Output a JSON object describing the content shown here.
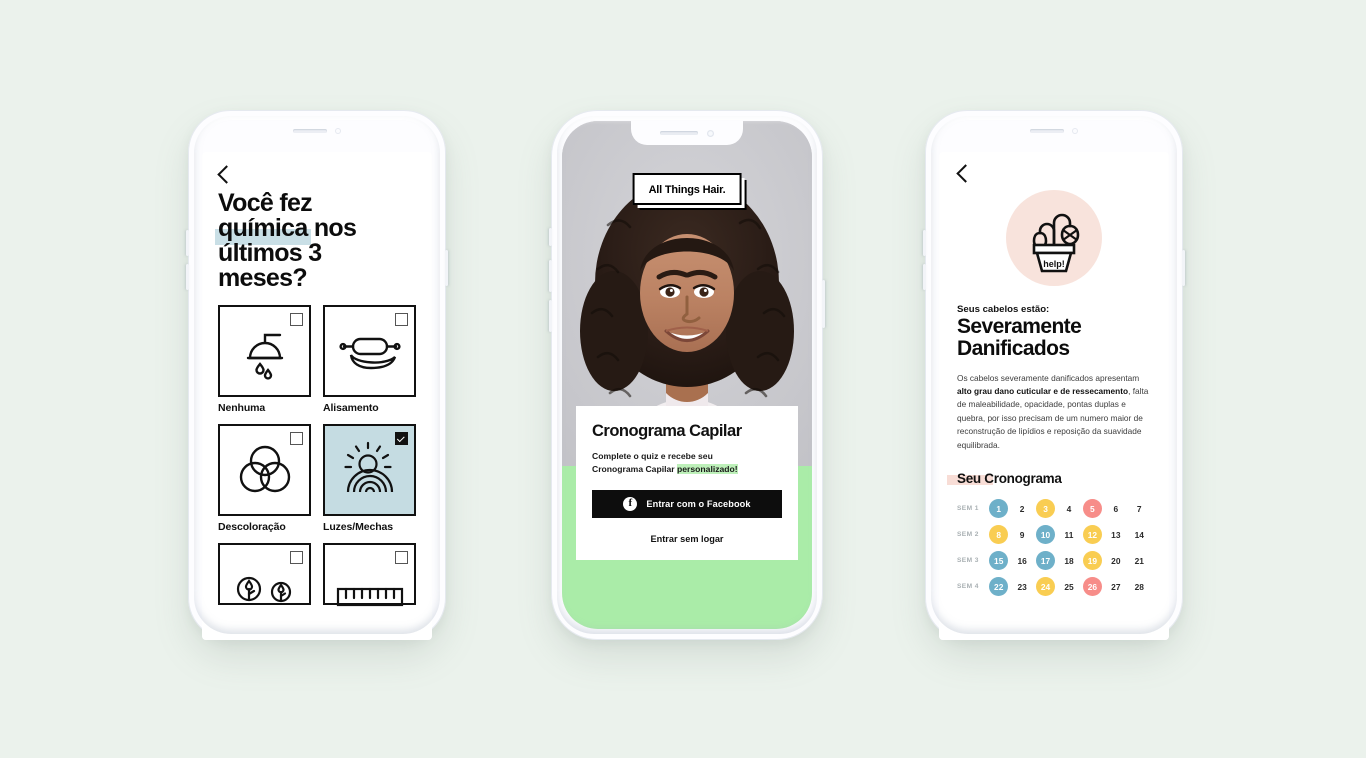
{
  "background_color": "#ebf2ec",
  "phone1": {
    "name": "quiz-screen",
    "back_icon": "back-chevron-icon",
    "title_lines": [
      "Você fez",
      "química",
      " nos",
      "últimos 3",
      "meses?"
    ],
    "title_full": "Você fez química nos últimos 3 meses?",
    "highlight_word": "química",
    "highlight_color": "#c9dfe6",
    "selected_color": "#c5dce2",
    "options": [
      {
        "label": "Nenhuma",
        "icon": "shower-head-icon",
        "selected": false
      },
      {
        "label": "Alisamento",
        "icon": "rolling-pin-icon",
        "selected": false
      },
      {
        "label": "Descoloração",
        "icon": "three-circles-icon",
        "selected": false
      },
      {
        "label": "Luzes/Mechas",
        "icon": "sun-rainbow-icon",
        "selected": true
      },
      {
        "label": "",
        "icon": "two-droplet-trees-icon",
        "selected": false
      },
      {
        "label": "",
        "icon": "ruler-icon",
        "selected": false
      }
    ]
  },
  "phone2": {
    "name": "login-screen",
    "logo": "All Things Hair.",
    "photo_alt": "smiling-woman-curly-hair-photo",
    "photo_bg": "#c9c9cd",
    "green_bg": "#aaeca8",
    "card": {
      "title": "Cronograma Capilar",
      "subtitle_line1": "Complete o quiz e recebe seu",
      "subtitle_line2_a": "Cronograma Capilar ",
      "subtitle_line2_b": "personalizado!",
      "facebook_button": "Entrar com o Facebook",
      "facebook_icon": "facebook-icon",
      "guest_link": "Entrar sem logar"
    }
  },
  "phone3": {
    "name": "result-screen",
    "back_icon": "back-chevron-icon",
    "illustration": "wilting-plant-help-icon",
    "illustration_label": "help!",
    "illustration_bg": "#f8e3dc",
    "eyebrow": "Seus cabelos estão:",
    "title_line1": "Severamente",
    "title_line2": "Danificados",
    "body_a": "Os cabelos severamente danificados apresentam ",
    "body_b": "alto grau dano cuticular e de ressecamento",
    "body_c": ", falta de maleabilidade, opacidade, pontas duplas e quebra, por isso precisam de um numero maior de reconstrução de lipídios e reposição da suavidade equilibrada.",
    "section_title": "Seu Cronograma",
    "section_highlight_color": "#f8ddd6",
    "calendar": {
      "legend_colors": {
        "blue": "#6eb0c9",
        "yellow": "#f9cd52",
        "pink": "#f78d89"
      },
      "rows": [
        {
          "week": "SEM 1",
          "days": [
            {
              "n": "1",
              "color": "blue"
            },
            {
              "n": "2",
              "color": null
            },
            {
              "n": "3",
              "color": "yellow"
            },
            {
              "n": "4",
              "color": null
            },
            {
              "n": "5",
              "color": "pink"
            },
            {
              "n": "6",
              "color": null
            },
            {
              "n": "7",
              "color": null
            }
          ]
        },
        {
          "week": "SEM 2",
          "days": [
            {
              "n": "8",
              "color": "yellow"
            },
            {
              "n": "9",
              "color": null
            },
            {
              "n": "10",
              "color": "blue"
            },
            {
              "n": "11",
              "color": null
            },
            {
              "n": "12",
              "color": "yellow"
            },
            {
              "n": "13",
              "color": null
            },
            {
              "n": "14",
              "color": null
            }
          ]
        },
        {
          "week": "SEM 3",
          "days": [
            {
              "n": "15",
              "color": "blue"
            },
            {
              "n": "16",
              "color": null
            },
            {
              "n": "17",
              "color": "blue"
            },
            {
              "n": "18",
              "color": null
            },
            {
              "n": "19",
              "color": "yellow"
            },
            {
              "n": "20",
              "color": null
            },
            {
              "n": "21",
              "color": null
            }
          ]
        },
        {
          "week": "SEM 4",
          "days": [
            {
              "n": "22",
              "color": "blue"
            },
            {
              "n": "23",
              "color": null
            },
            {
              "n": "24",
              "color": "yellow"
            },
            {
              "n": "25",
              "color": null
            },
            {
              "n": "26",
              "color": "pink"
            },
            {
              "n": "27",
              "color": null
            },
            {
              "n": "28",
              "color": null
            }
          ]
        }
      ]
    }
  }
}
